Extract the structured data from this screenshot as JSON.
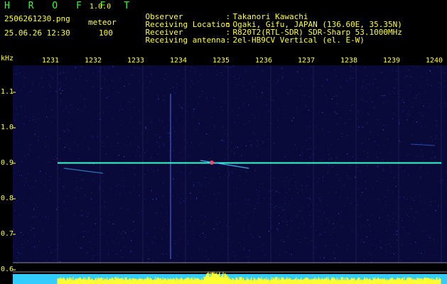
{
  "header": {
    "app_name": "H R O F F T",
    "app_version": "1.0.0",
    "file_name": "2506261230.png",
    "mode": "meteor",
    "datetime": "25.06.26 12:30",
    "count": "100",
    "info": [
      {
        "label": "Observer",
        "value": "Takanori Kawachi"
      },
      {
        "label": "Receiving Location",
        "value": "Ogaki, Gifu, JAPAN (136.60E, 35.35N)"
      },
      {
        "label": "Receiver",
        "value": "R820T2(RTL-SDR) SDR-Sharp 53.1000MHz"
      },
      {
        "label": "Receiving antenna",
        "value": "2el-HB9CV Vertical (el. E-W)"
      }
    ]
  },
  "waterfall": {
    "x_unit": "kHz",
    "x_ticks": [
      "1231",
      "1232",
      "1233",
      "1234",
      "1235",
      "1236",
      "1237",
      "1238",
      "1239",
      "1240"
    ],
    "y_ticks": [
      "1.1",
      "1.0",
      "0.9",
      "0.8",
      "0.7",
      "0.6"
    ],
    "colors": {
      "background": "#0a0a3a",
      "grid": "#3a3a8a",
      "carrier": "#33ffcc",
      "labels": "#ffff33",
      "spectrum_low": "#33ccff",
      "spectrum_high": "#ffff33"
    }
  }
}
